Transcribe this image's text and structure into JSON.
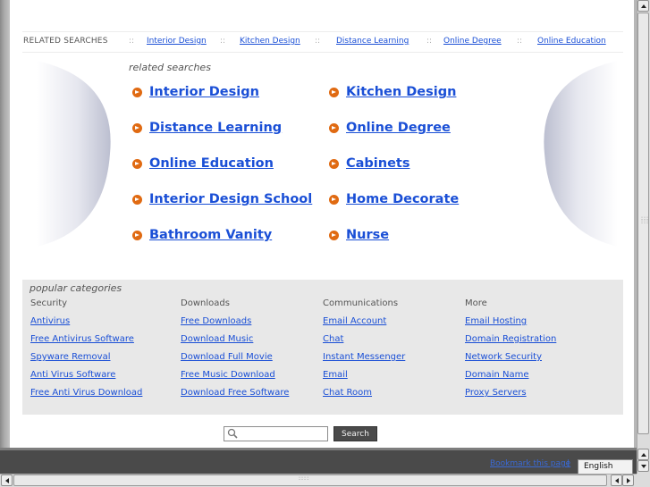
{
  "top_related": {
    "label": "RELATED SEARCHES",
    "separator": "::",
    "links": [
      "Interior Design",
      "Kitchen Design",
      "Distance Learning",
      "Online Degree",
      "Online Education"
    ]
  },
  "related_searches": {
    "title": "related searches",
    "links": [
      "Interior Design",
      "Kitchen Design",
      "Distance Learning",
      "Online Degree",
      "Online Education",
      "Cabinets",
      "Interior Design School",
      "Home Decorate",
      "Bathroom Vanity",
      "Nurse"
    ]
  },
  "popular_categories": {
    "title": "popular categories",
    "columns": [
      {
        "heading": "Security",
        "links": [
          "Antivirus",
          "Free Antivirus Software",
          "Spyware Removal",
          "Anti Virus Software",
          "Free Anti Virus Download"
        ]
      },
      {
        "heading": "Downloads",
        "links": [
          "Free Downloads",
          "Download Music",
          "Download Full Movie",
          "Free Music Download",
          "Download Free Software"
        ]
      },
      {
        "heading": "Communications",
        "links": [
          "Email Account",
          "Chat",
          "Instant Messenger",
          "Email",
          "Chat Room"
        ]
      },
      {
        "heading": "More",
        "links": [
          "Email Hosting",
          "Domain Registration",
          "Network Security",
          "Domain Name",
          "Proxy Servers"
        ]
      }
    ]
  },
  "search": {
    "value": "",
    "button_label": "Search"
  },
  "footer": {
    "bookmark_label": "Bookmark this page",
    "bookmark_separator": "|",
    "language": "English"
  },
  "icons": {
    "bullet": "arrow-circle-icon",
    "search": "magnifier-icon"
  },
  "colors": {
    "link": "#1a4fd6",
    "bullet": "#e06a12",
    "panel": "#e8e8e8"
  }
}
